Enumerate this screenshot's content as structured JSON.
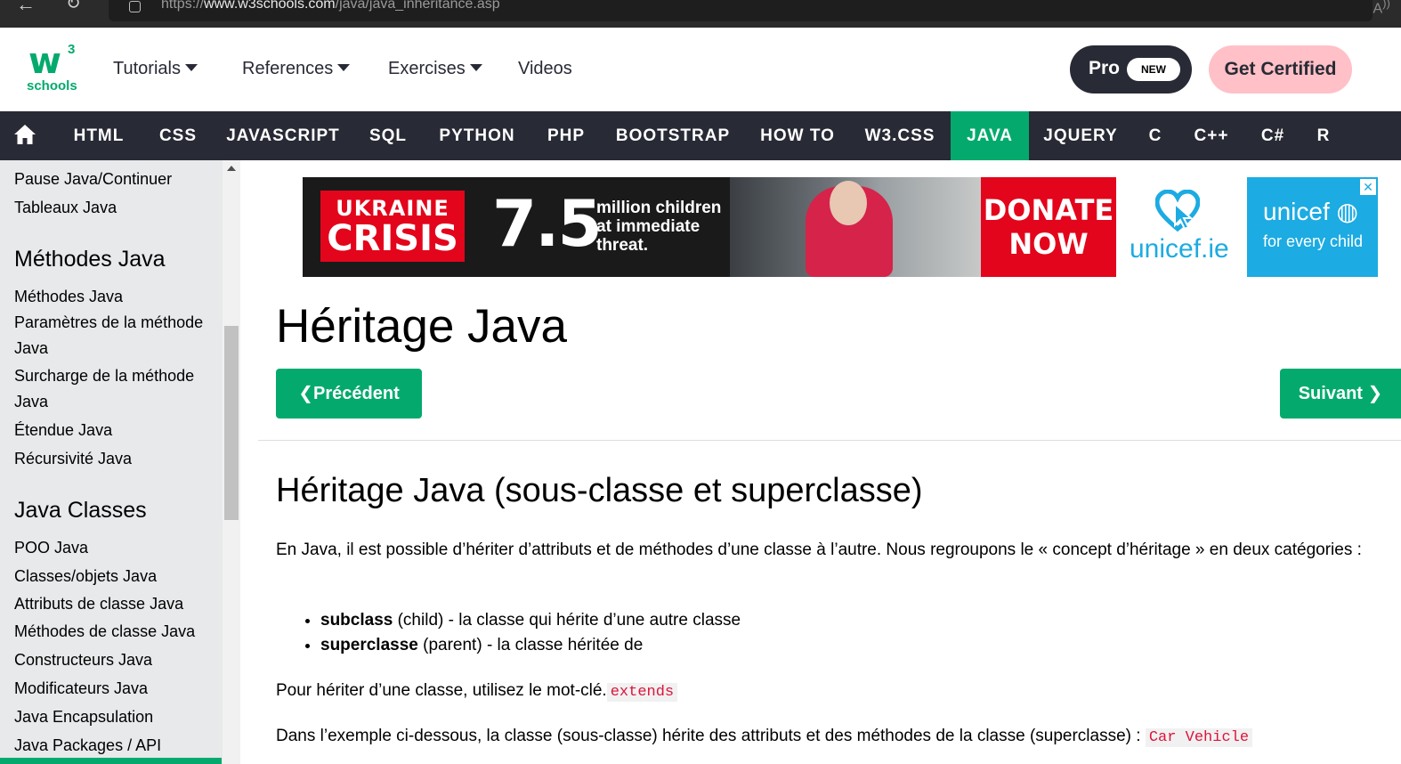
{
  "browser": {
    "url_prefix": "https://",
    "url_domain": "www.w3schools.com",
    "url_path": "/java/java_inheritance.asp"
  },
  "header": {
    "logo_text": "schools",
    "logo_sup": "3",
    "menu": [
      "Tutorials",
      "References",
      "Exercises",
      "Videos"
    ],
    "pro_label": "Pro",
    "pro_badge": "NEW",
    "cert_label": "Get Certified"
  },
  "navbar": {
    "items": [
      "HTML",
      "CSS",
      "JAVASCRIPT",
      "SQL",
      "PYTHON",
      "PHP",
      "BOOTSTRAP",
      "HOW TO",
      "W3.CSS",
      "JAVA",
      "JQUERY",
      "C",
      "C++",
      "C#",
      "R"
    ],
    "active": "JAVA"
  },
  "sidebar": {
    "links_top": [
      "Pause Java/Continuer",
      "Tableaux Java"
    ],
    "section1": "Méthodes Java",
    "section1_links": [
      "Méthodes Java",
      "Paramètres de la méthode Java",
      "Surcharge de la méthode Java",
      "Étendue Java",
      "Récursivité Java"
    ],
    "section2": "Java Classes",
    "section2_links": [
      "POO Java",
      "Classes/objets Java",
      "Attributs de classe Java",
      "Méthodes de classe Java",
      "Constructeurs Java",
      "Modificateurs Java",
      "Java Encapsulation",
      "Java Packages / API"
    ]
  },
  "ad": {
    "ukraine_l1": "UKRAINE",
    "ukraine_l2": "CRISIS",
    "big_number": "7.5",
    "threat_l1": "million children",
    "threat_l2": "at immediate",
    "threat_l3": "threat.",
    "donate_l1": "DONATE",
    "donate_l2": "NOW",
    "unicef_ie": "unicef.ie",
    "unicef": "unicef",
    "tagline": "for every child"
  },
  "content": {
    "title": "Héritage Java",
    "prev": "Précédent",
    "next": "Suivant",
    "section_title": "Héritage Java (sous-classe et superclasse)",
    "para1": "En Java, il est possible d’hériter d’attributs et de méthodes d’une classe à l’autre. Nous regroupons le « concept d’héritage » en deux catégories :",
    "bullet1_bold": "subclass",
    "bullet1_rest": " (child) - la classe qui hérite d’une autre classe",
    "bullet2_bold": "superclasse",
    "bullet2_rest": " (parent) - la classe héritée de",
    "para2": "Pour hériter d’une classe, utilisez le mot-clé.",
    "para2_code": "extends",
    "para3": "Dans l’exemple ci-dessous, la classe (sous-classe) hérite des attributs et des méthodes de la classe (superclasse) : ",
    "para3_code": "Car Vehicle"
  }
}
